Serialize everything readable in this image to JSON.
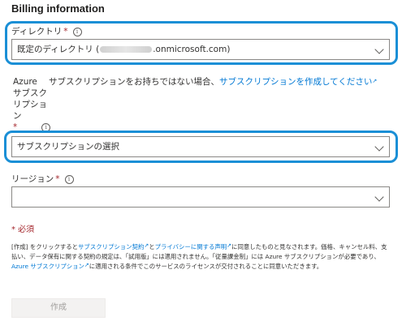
{
  "page": {
    "title": "Billing information"
  },
  "directory": {
    "label": "ディレクトリ",
    "required": "*",
    "value_prefix": "既定のディレクトリ (",
    "value_suffix": ".onmicrosoft.com)"
  },
  "subscription": {
    "label_lines": [
      "Azure",
      "サブスク",
      "リプショ",
      "ン"
    ],
    "required": "*",
    "hint": "サブスクリプションをお持ちではない場合、",
    "hint_link": "サブスクリプションを作成してください",
    "placeholder": "サブスクリプションの選択"
  },
  "region": {
    "label": "リージョン",
    "required": "*",
    "value": ""
  },
  "required_note": "* 必須",
  "terms": {
    "p1": "[作成] をクリックすると",
    "link1": "サブスクリプション契約",
    "p2": "と",
    "link2": "プライバシーに関する声明",
    "p3": "に同意したものと見なされます。価格、キャンセル料、支払い、データ保有に関する契約の規定は、「試用版」には適用されません。「従量課金制」には Azure サブスクリプションが必要であり、",
    "link3": "Azure サブスクリプション",
    "p4": "に適用される条件でこのサービスのライセンスが交付されることに同意いただきます。"
  },
  "create_button": "作成",
  "colors": {
    "accent": "#0078d4",
    "highlight": "#1a8fd6",
    "required": "#a4262c"
  },
  "icons": {
    "info": "info-icon",
    "chevron": "chevron-down-icon",
    "external": "external-link-icon"
  }
}
